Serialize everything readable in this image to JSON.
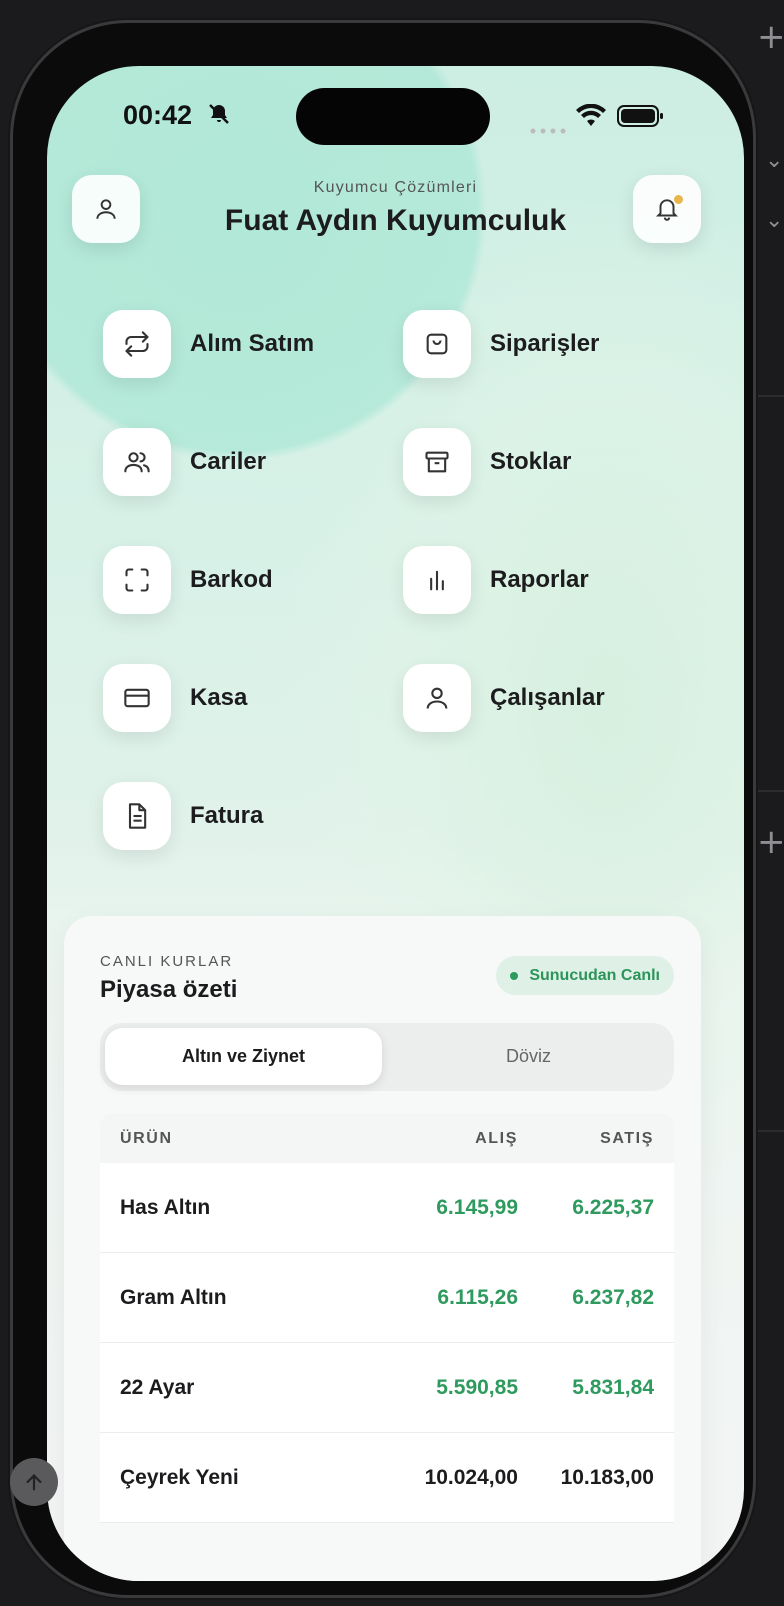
{
  "status_bar": {
    "time": "00:42"
  },
  "header": {
    "subtitle": "Kuyumcu Çözümleri",
    "title": "Fuat Aydın Kuyumculuk"
  },
  "menu": [
    {
      "label": "Alım Satım",
      "icon": "swap-arrows-icon"
    },
    {
      "label": "Siparişler",
      "icon": "shopping-bag-icon"
    },
    {
      "label": "Cariler",
      "icon": "users-icon"
    },
    {
      "label": "Stoklar",
      "icon": "archive-box-icon"
    },
    {
      "label": "Barkod",
      "icon": "scan-frame-icon"
    },
    {
      "label": "Raporlar",
      "icon": "bar-chart-icon"
    },
    {
      "label": "Kasa",
      "icon": "credit-card-icon"
    },
    {
      "label": "Çalışanlar",
      "icon": "user-icon"
    },
    {
      "label": "Fatura",
      "icon": "document-icon"
    }
  ],
  "rates": {
    "eyebrow": "CANLI KURLAR",
    "title": "Piyasa özeti",
    "badge": "Sunucudan Canlı",
    "tabs": [
      "Altın ve Ziynet",
      "Döviz"
    ],
    "columns": [
      "ÜRÜN",
      "ALIŞ",
      "SATIŞ"
    ],
    "rows": [
      {
        "name": "Has Altın",
        "buy": "6.145,99",
        "sell": "6.225,37",
        "color": "#2f9a5e"
      },
      {
        "name": "Gram Altın",
        "buy": "6.115,26",
        "sell": "6.237,82",
        "color": "#2f9a5e"
      },
      {
        "name": "22 Ayar",
        "buy": "5.590,85",
        "sell": "5.831,84",
        "color": "#2f9a5e"
      },
      {
        "name": "Çeyrek Yeni",
        "buy": "10.024,00",
        "sell": "10.183,00",
        "color": "#1c1c1e"
      }
    ]
  },
  "colors": {
    "accent_green": "#2f9a5e",
    "notification_dot": "#e8b64a"
  }
}
